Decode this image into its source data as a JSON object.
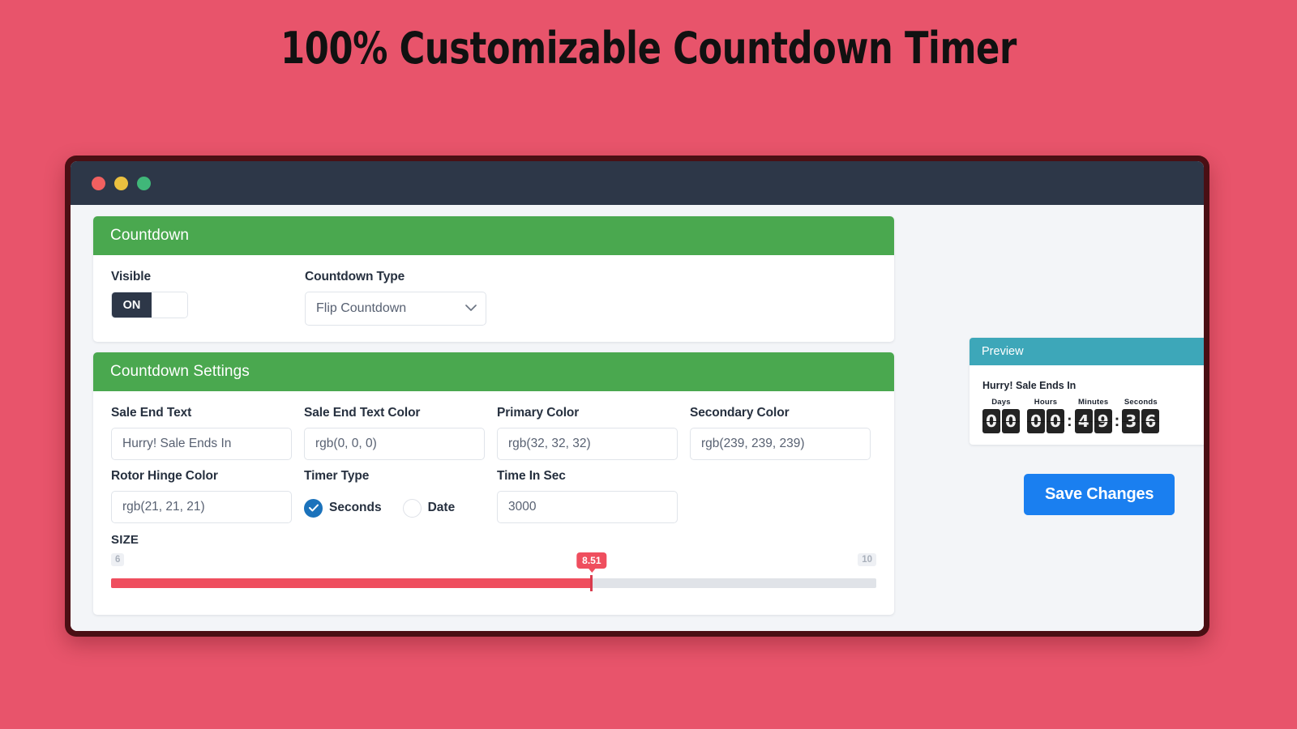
{
  "page": {
    "headline": "100% Customizable Countdown Timer",
    "background_color": "#e8546b"
  },
  "window": {
    "titlebar": {
      "dots": [
        "close-red",
        "minimize-yellow",
        "maximize-green"
      ]
    }
  },
  "countdown_card": {
    "header": "Countdown",
    "visible": {
      "label": "Visible",
      "toggle_state": "ON"
    },
    "countdown_type": {
      "label": "Countdown Type",
      "value": "Flip Countdown",
      "options": [
        "Flip Countdown"
      ],
      "chevron": "chevron-down-icon"
    }
  },
  "settings_card": {
    "header": "Countdown Settings",
    "fields": {
      "sale_end_text": {
        "label": "Sale End Text",
        "value": "Hurry! Sale Ends In"
      },
      "sale_end_text_color": {
        "label": "Sale End Text Color",
        "value": "rgb(0, 0, 0)"
      },
      "primary_color": {
        "label": "Primary Color",
        "value": "rgb(32, 32, 32)"
      },
      "secondary_color": {
        "label": "Secondary Color",
        "value": "rgb(239, 239, 239)"
      },
      "rotor_hinge_color": {
        "label": "Rotor Hinge Color",
        "value": "rgb(21, 21, 21)"
      },
      "timer_type": {
        "label": "Timer Type",
        "selected": "Seconds",
        "options": [
          "Seconds",
          "Date"
        ]
      },
      "time_in_sec": {
        "label": "Time In Sec",
        "value": "3000"
      }
    },
    "size_slider": {
      "label": "SIZE",
      "min": "6",
      "max": "10",
      "value": "8.51",
      "fill_percent": 62.8,
      "fill_color": "#ef4e5e",
      "track_color": "#e0e3e8"
    }
  },
  "preview": {
    "header": "Preview",
    "header_color": "#3da7b9",
    "sale_text": "Hurry! Sale Ends In",
    "units": [
      {
        "label": "Days",
        "digits": [
          "0",
          "0"
        ]
      },
      {
        "label": "Hours",
        "digits": [
          "0",
          "0"
        ]
      },
      {
        "label": "Minutes",
        "digits": [
          "4",
          "9"
        ]
      },
      {
        "label": "Seconds",
        "digits": [
          "3",
          "6"
        ]
      }
    ],
    "separator": ":",
    "save_button": "Save Changes",
    "save_button_color": "#1a7ff0"
  }
}
